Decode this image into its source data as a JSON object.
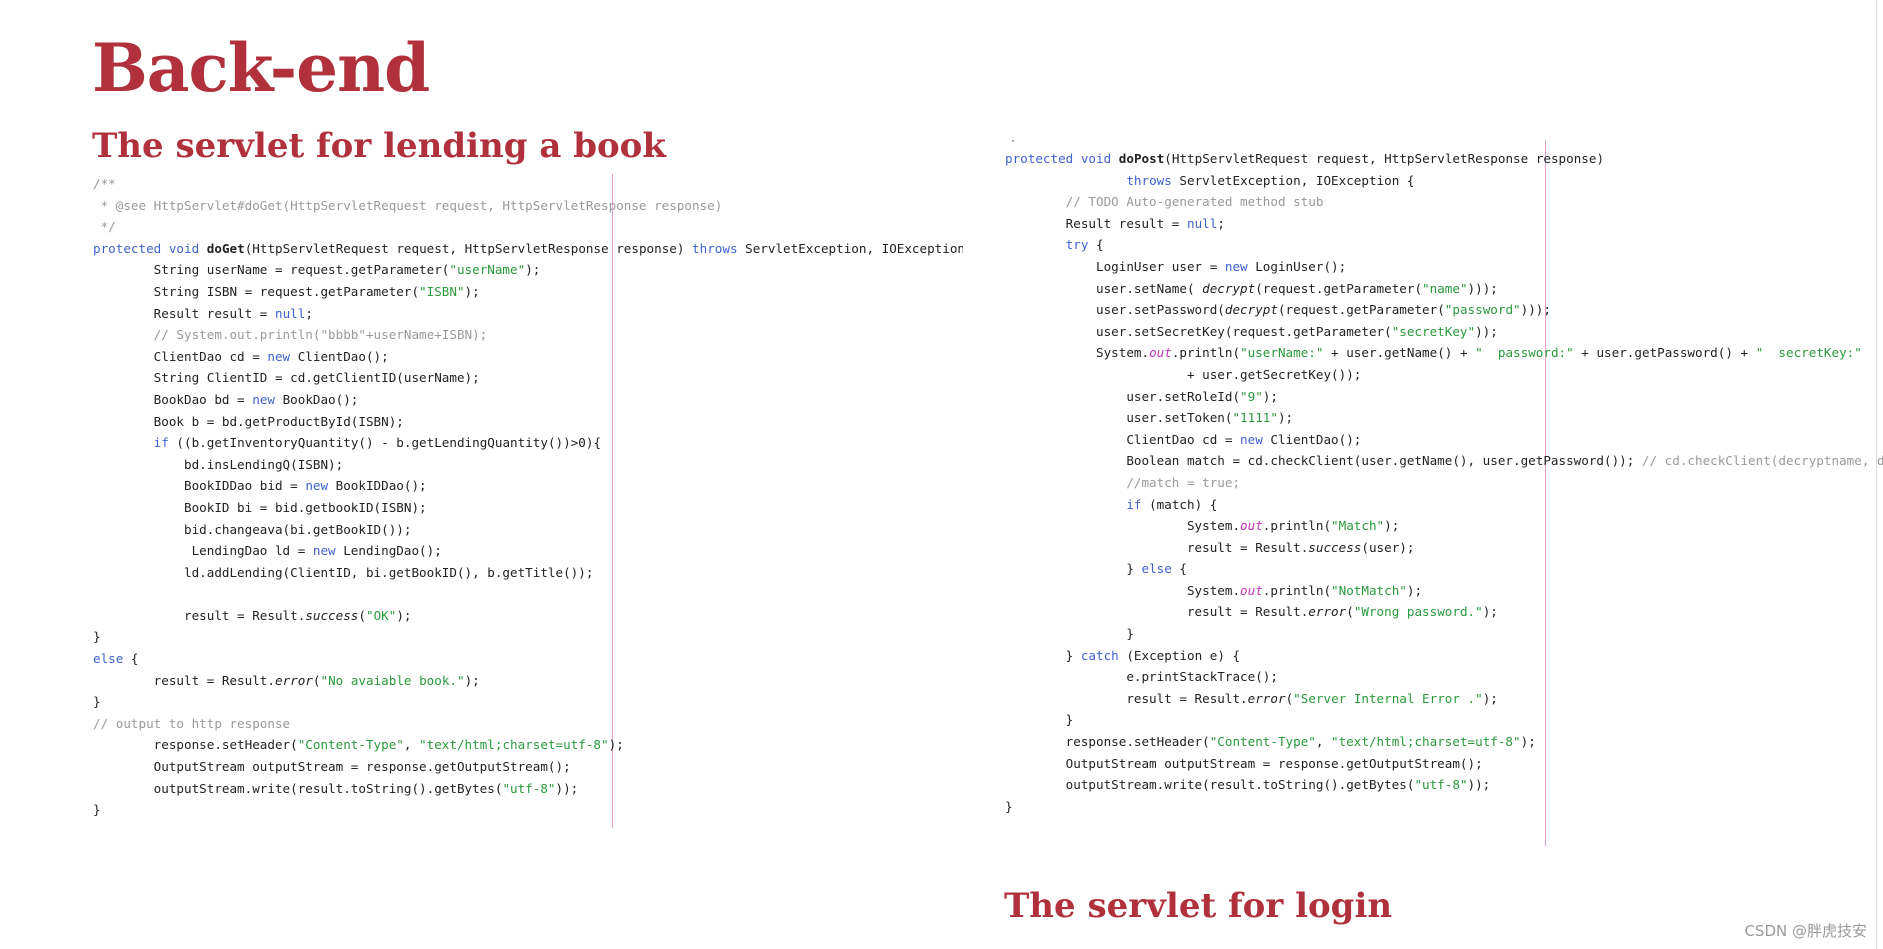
{
  "heading": "Back-end",
  "lending_section": {
    "title": "The servlet for lending a book",
    "code_lines": [
      "/**",
      " * @see HttpServlet#doGet(HttpServletRequest request, HttpServletResponse response)",
      " */",
      "protected void doGet(HttpServletRequest request, HttpServletResponse response) throws ServletException, IOException {",
      "        String userName = request.getParameter(\"userName\");",
      "        String ISBN = request.getParameter(\"ISBN\");",
      "        Result result = null;",
      "        // System.out.println(\"bbbb\"+userName+ISBN);",
      "        ClientDao cd = new ClientDao();",
      "        String ClientID = cd.getClientID(userName);",
      "        BookDao bd = new BookDao();",
      "        Book b = bd.getProductById(ISBN);",
      "        if ((b.getInventoryQuantity() - b.getLendingQuantity())>0){",
      "            bd.insLendingQ(ISBN);",
      "            BookIDDao bid = new BookIDDao();",
      "            BookID bi = bid.getbookID(ISBN);",
      "            bid.changeava(bi.getBookID());",
      "             LendingDao ld = new LendingDao();",
      "            ld.addLending(ClientID, bi.getBookID(), b.getTitle());",
      "",
      "            result = Result.success(\"OK\");",
      "}",
      "else {",
      "        result = Result.error(\"No avaiable book.\");",
      "}",
      "// output to http response",
      "        response.setHeader(\"Content-Type\", \"text/html;charset=utf-8\");",
      "        OutputStream outputStream = response.getOutputStream();",
      "        outputStream.write(result.toString().getBytes(\"utf-8\"));",
      "}"
    ]
  },
  "login_section": {
    "title": "The servlet for login",
    "code_lines": [
      "protected void doPost(HttpServletRequest request, HttpServletResponse response)",
      "                throws ServletException, IOException {",
      "        // TODO Auto-generated method stub",
      "        Result result = null;",
      "        try {",
      "            LoginUser user = new LoginUser();",
      "            user.setName( decrypt(request.getParameter(\"name\")));",
      "            user.setPassword(decrypt(request.getParameter(\"password\")));",
      "            user.setSecretKey(request.getParameter(\"secretKey\"));",
      "            System.out.println(\"userName:\" + user.getName() + \"  password:\" + user.getPassword() + \"  secretKey:\"",
      "                        + user.getSecretKey());",
      "                user.setRoleId(\"9\");",
      "                user.setToken(\"1111\");",
      "                ClientDao cd = new ClientDao();",
      "                Boolean match = cd.checkClient(user.getName(), user.getPassword()); // cd.checkClient(decryptname, de",
      "                //match = true;",
      "                if (match) {",
      "                        System.out.println(\"Match\");",
      "                        result = Result.success(user);",
      "                } else {",
      "                        System.out.println(\"NotMatch\");",
      "                        result = Result.error(\"Wrong password.\");",
      "                }",
      "        } catch (Exception e) {",
      "                e.printStackTrace();",
      "                result = Result.error(\"Server Internal Error .\");",
      "        }",
      "        response.setHeader(\"Content-Type\", \"text/html;charset=utf-8\");",
      "        OutputStream outputStream = response.getOutputStream();",
      "        outputStream.write(result.toString().getBytes(\"utf-8\"));",
      "}"
    ]
  },
  "watermark": "CSDN @胖虎技安",
  "colors": {
    "heading": "#b0313b",
    "keyword": "#3f62d0",
    "string": "#2a9a3c",
    "comment": "#9a9a9a",
    "static_field": "#c236b8",
    "guide_line": "#e8a0cf"
  }
}
